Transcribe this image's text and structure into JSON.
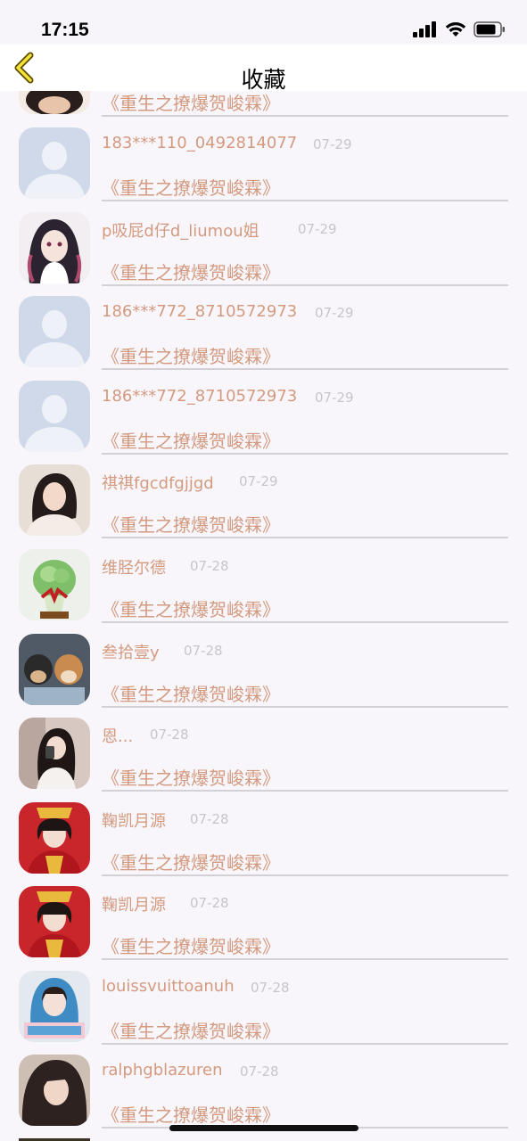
{
  "status": {
    "time": "17:15"
  },
  "header": {
    "title": "收藏"
  },
  "partial_top": {
    "book": "《重生之撩爆贺峻霖》"
  },
  "rows": [
    {
      "name": "183***110_0492814077",
      "date": "07-29",
      "book": "《重生之撩爆贺峻霖》",
      "avatar": "default-avatar"
    },
    {
      "name": "p吸屁d仔d_liumou姐",
      "date": "07-29",
      "book": "《重生之撩爆贺峻霖》",
      "avatar": "anime-girl-avatar"
    },
    {
      "name": "186***772_8710572973",
      "date": "07-29",
      "book": "《重生之撩爆贺峻霖》",
      "avatar": "default-avatar"
    },
    {
      "name": "186***772_8710572973",
      "date": "07-29",
      "book": "《重生之撩爆贺峻霖》",
      "avatar": "default-avatar"
    },
    {
      "name": "祺祺fgcdfgjjgd",
      "date": "07-29",
      "book": "《重生之撩爆贺峻霖》",
      "avatar": "girl-photo-avatar"
    },
    {
      "name": "维胫尔德",
      "date": "07-28",
      "book": "《重生之撩爆贺峻霖》",
      "avatar": "cabbage-avatar"
    },
    {
      "name": "叁拾壹y",
      "date": "07-28",
      "book": "《重生之撩爆贺峻霖》",
      "avatar": "dogs-avatar"
    },
    {
      "name": "恩...",
      "date": "07-28",
      "book": "《重生之撩爆贺峻霖》",
      "avatar": "mirror-selfie-avatar"
    },
    {
      "name": "鞠凯月源",
      "date": "07-28",
      "book": "《重生之撩爆贺峻霖》",
      "avatar": "red-costume-avatar"
    },
    {
      "name": "鞠凯月源",
      "date": "07-28",
      "book": "《重生之撩爆贺峻霖》",
      "avatar": "red-costume-avatar"
    },
    {
      "name": "louissvuittoanuh",
      "date": "07-28",
      "book": "《重生之撩爆贺峻霖》",
      "avatar": "blue-hood-avatar"
    },
    {
      "name": "ralphgblazuren",
      "date": "07-28",
      "book": "《重生之撩爆贺峻霖》",
      "avatar": "long-hair-avatar"
    }
  ]
}
